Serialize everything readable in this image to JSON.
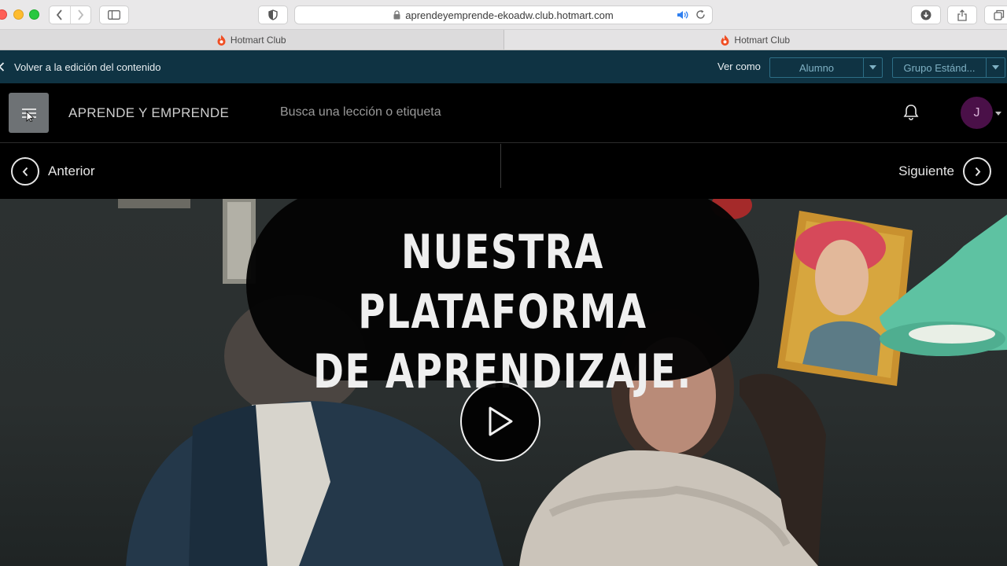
{
  "browser": {
    "url": "aprendeyemprende-ekoadw.club.hotmart.com",
    "tabs": [
      {
        "label": "Hotmart Club"
      },
      {
        "label": "Hotmart Club"
      }
    ]
  },
  "editbar": {
    "back_label": "Volver a la edición del contenido",
    "view_as_label": "Ver como",
    "view_as_value": "Alumno",
    "group_value": "Grupo Estánd..."
  },
  "header": {
    "brand": "APRENDE Y EMPRENDE",
    "search_placeholder": "Busca una lección o etiqueta",
    "avatar_initial": "J"
  },
  "lesson_nav": {
    "prev_label": "Anterior",
    "next_label": "Siguiente"
  },
  "video": {
    "headline_line1": "NUESTRA PLATAFORMA",
    "headline_line2": "DE APRENDIZAJE."
  },
  "colors": {
    "editbar_bg": "#0f3343",
    "select_border": "#2d6e86",
    "avatar_bg": "#4a1048",
    "hotmart_flame": "#f04e23"
  }
}
